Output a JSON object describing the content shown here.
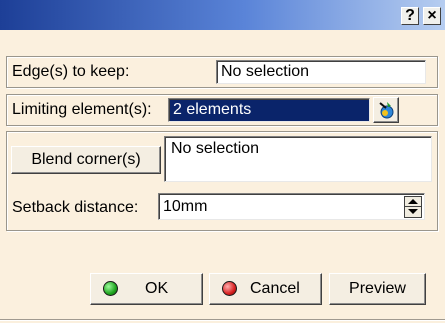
{
  "titlebar": {
    "help_label": "?",
    "close_label": "×"
  },
  "edges": {
    "label": "Edge(s) to keep:",
    "value": "No selection"
  },
  "limiting": {
    "label": "Limiting element(s):",
    "value": "2 elements"
  },
  "blend": {
    "button_label": "Blend corner(s)",
    "value": "No selection"
  },
  "setback": {
    "label": "Setback distance:",
    "value": "10mm"
  },
  "buttons": {
    "ok": "OK",
    "cancel": "Cancel",
    "preview": "Preview"
  },
  "colors": {
    "title_bar": "#1d3f97",
    "dialog_bg": "#fbf0de",
    "selection": "#0a246a",
    "ok_dot": "#1fa51f",
    "cancel_dot": "#d82020"
  }
}
